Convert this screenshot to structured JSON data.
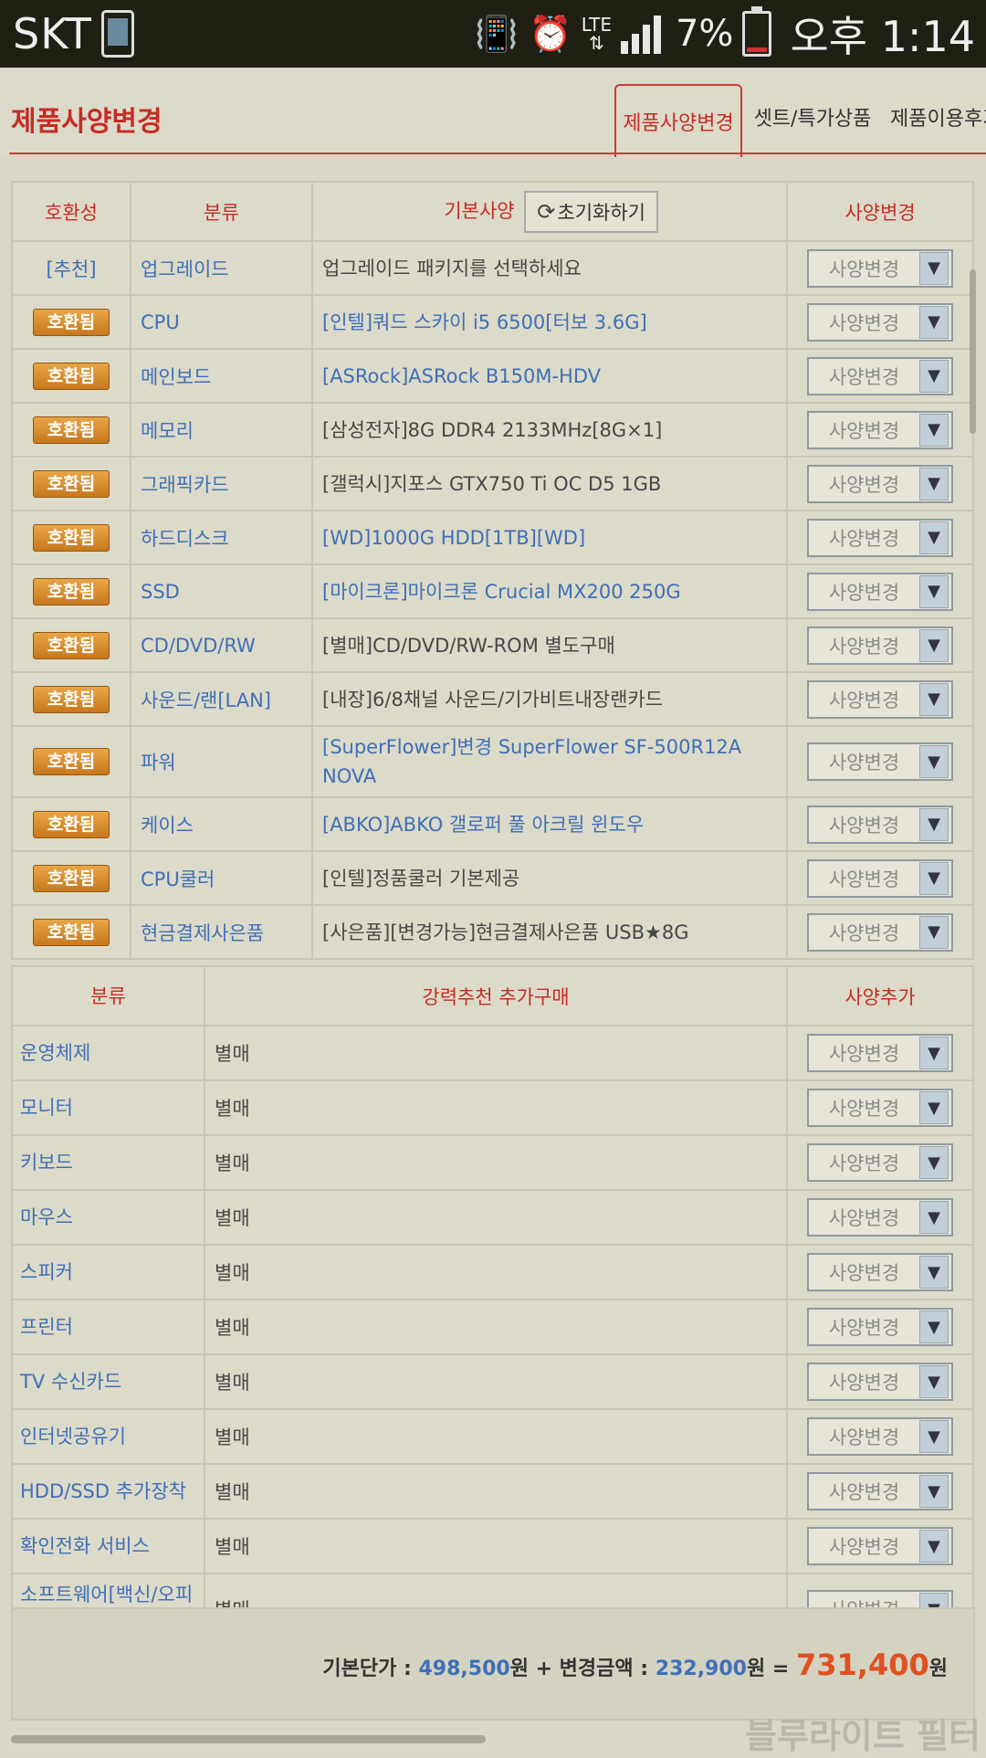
{
  "status_bar": {
    "carrier": "SKT",
    "network": "LTE",
    "battery": "7%",
    "time": "오후 1:14"
  },
  "header": {
    "title": "제품사양변경",
    "tabs": [
      "제품사양변경",
      "셋트/특가상품",
      "제품이용후기"
    ]
  },
  "spec_table": {
    "headers": {
      "compat": "호환성",
      "category": "분류",
      "spec": "기본사양",
      "reset": "초기화하기",
      "change": "사양변경"
    },
    "select_label": "사양변경",
    "rows": [
      {
        "compat": "[추천]",
        "category": "업그레이드",
        "spec": "업그레이드 패키지를 선택하세요",
        "link": false
      },
      {
        "compat": "호환됨",
        "category": "CPU",
        "spec": "[인텔]쿼드 스카이 i5 6500[터보 3.6G]",
        "link": true
      },
      {
        "compat": "호환됨",
        "category": "메인보드",
        "spec": "[ASRock]ASRock B150M-HDV",
        "link": true
      },
      {
        "compat": "호환됨",
        "category": "메모리",
        "spec": "[삼성전자]8G DDR4 2133MHz[8G×1]",
        "link": false
      },
      {
        "compat": "호환됨",
        "category": "그래픽카드",
        "spec": "[갤럭시]지포스 GTX750 Ti OC D5 1GB",
        "link": false
      },
      {
        "compat": "호환됨",
        "category": "하드디스크",
        "spec": "[WD]1000G HDD[1TB][WD]",
        "link": true
      },
      {
        "compat": "호환됨",
        "category": "SSD",
        "spec": "[마이크론]마이크론 Crucial MX200 250G",
        "link": true
      },
      {
        "compat": "호환됨",
        "category": "CD/DVD/RW",
        "spec": "[별매]CD/DVD/RW-ROM 별도구매",
        "link": false
      },
      {
        "compat": "호환됨",
        "category": "사운드/랜[LAN]",
        "spec": "[내장]6/8채널 사운드/기가비트내장랜카드",
        "link": false
      },
      {
        "compat": "호환됨",
        "category": "파워",
        "spec": "[SuperFlower]변경 SuperFlower SF-500R12A NOVA",
        "link": true
      },
      {
        "compat": "호환됨",
        "category": "케이스",
        "spec": "[ABKO]ABKO 갤로퍼 풀 아크릴 윈도우",
        "link": true
      },
      {
        "compat": "호환됨",
        "category": "CPU쿨러",
        "spec": "[인텔]정품쿨러 기본제공",
        "link": false
      },
      {
        "compat": "호환됨",
        "category": "현금결제사은품",
        "spec": "[사은품][변경가능]현금결제사은품 USB★8G",
        "link": false
      }
    ]
  },
  "extra_table": {
    "headers": {
      "category": "분류",
      "item": "강력추천 추가구매",
      "add": "사양추가"
    },
    "select_label": "사양변경",
    "rows": [
      {
        "category": "운영체제",
        "item": "별매"
      },
      {
        "category": "모니터",
        "item": "별매"
      },
      {
        "category": "키보드",
        "item": "별매"
      },
      {
        "category": "마우스",
        "item": "별매"
      },
      {
        "category": "스피커",
        "item": "별매"
      },
      {
        "category": "프린터",
        "item": "별매"
      },
      {
        "category": "TV 수신카드",
        "item": "별매"
      },
      {
        "category": "인터넷공유기",
        "item": "별매"
      },
      {
        "category": "HDD/SSD 추가장착",
        "item": "별매"
      },
      {
        "category": "확인전화 서비스",
        "item": "별매"
      },
      {
        "category": "소프트웨어[백신/오피스]",
        "item": "별매"
      }
    ]
  },
  "total": {
    "base_label": "기본단가 :",
    "base_value": "498,500",
    "won1": "원 + 변경금액 :",
    "change_value": "232,900",
    "won2": "원 =",
    "grand_value": "731,400",
    "won3": "원"
  },
  "watermark": "블루라이트 필터"
}
